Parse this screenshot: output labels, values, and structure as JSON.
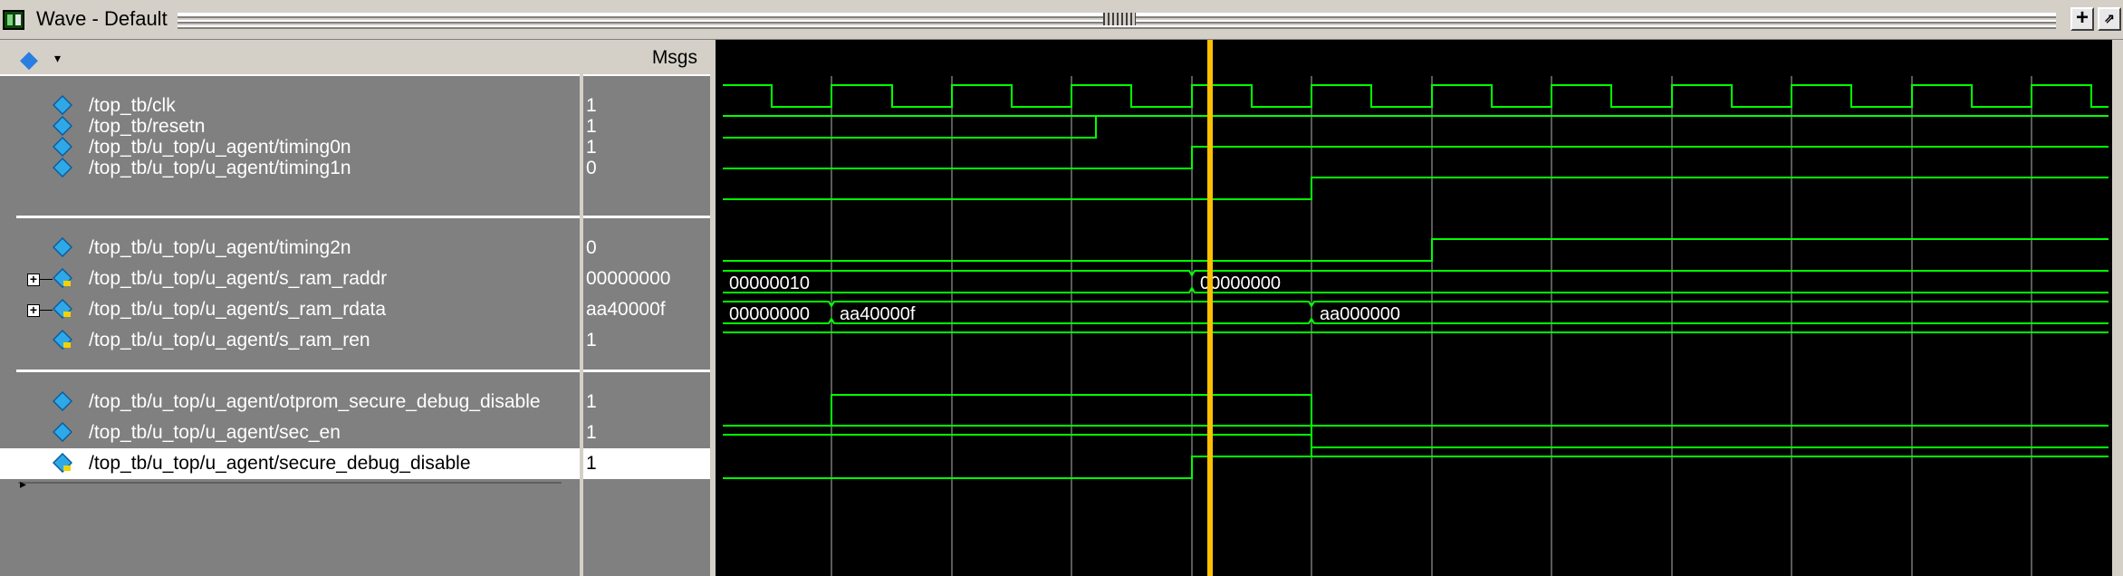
{
  "window": {
    "title": "Wave - Default",
    "icons": {
      "app": "wave-window-icon",
      "add": "plus-icon",
      "undock": "undock-icon"
    }
  },
  "header": {
    "msgs_label": "Msgs",
    "signal_type_icon": "diamond-icon",
    "dropdown_icon": "chevron-down-icon"
  },
  "colors": {
    "waveform": "#00ff00",
    "cursor": "#ffc000",
    "grid": "#b4b4b4",
    "bus_text": "#ffffff",
    "name_text": "#ffffff",
    "background": "#000000"
  },
  "signals": [
    {
      "name": "/top_tb/clk",
      "value": "1",
      "kind": "logic"
    },
    {
      "name": "/top_tb/resetn",
      "value": "1",
      "kind": "logic"
    },
    {
      "name": "/top_tb/u_top/u_agent/timing0n",
      "value": "1",
      "kind": "logic"
    },
    {
      "name": "/top_tb/u_top/u_agent/timing1n",
      "value": "0",
      "kind": "logic"
    },
    {
      "name": "/top_tb/u_top/u_agent/timing2n",
      "value": "0",
      "kind": "logic"
    },
    {
      "name": "/top_tb/u_top/u_agent/s_ram_raddr",
      "value": "00000000",
      "kind": "bus",
      "expandable": true,
      "segments": [
        "00000010",
        "00000000"
      ]
    },
    {
      "name": "/top_tb/u_top/u_agent/s_ram_rdata",
      "value": "aa40000f",
      "kind": "bus",
      "expandable": true,
      "segments": [
        "00000000",
        "aa40000f",
        "aa000000"
      ]
    },
    {
      "name": "/top_tb/u_top/u_agent/s_ram_ren",
      "value": "1",
      "kind": "logic"
    },
    {
      "name": "/top_tb/u_top/u_agent/otprom_secure_debug_disable",
      "value": "1",
      "kind": "logic"
    },
    {
      "name": "/top_tb/u_top/u_agent/sec_en",
      "value": "1",
      "kind": "logic"
    },
    {
      "name": "/top_tb/u_top/u_agent/secure_debug_disable",
      "value": "1",
      "kind": "logic",
      "selected": true
    }
  ]
}
